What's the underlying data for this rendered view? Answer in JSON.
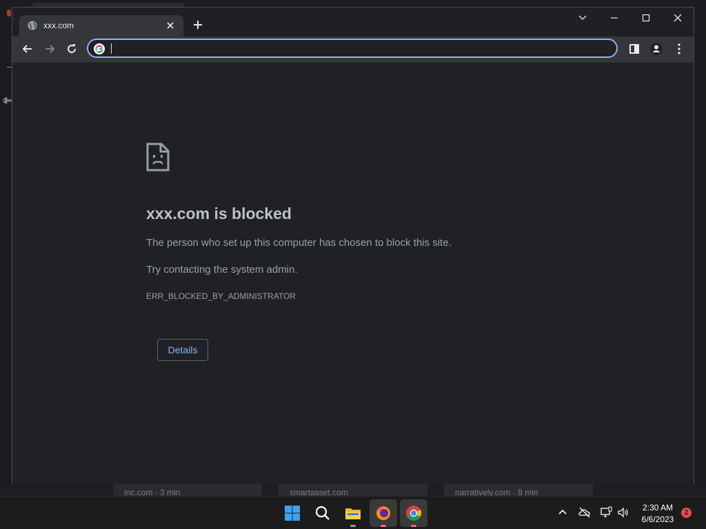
{
  "background": {
    "cards": [
      {
        "text": "inc.com · 3 min"
      },
      {
        "text": "smartasset.com"
      },
      {
        "text": "narratively.com · 8 min"
      }
    ]
  },
  "browser": {
    "tab": {
      "title": "xxx.com",
      "icon": "globe-icon"
    },
    "omnibox": {
      "value": "",
      "placeholder": ""
    },
    "accent": "#8ab4f8"
  },
  "error_page": {
    "heading": "xxx.com is blocked",
    "message": "The person who set up this computer has chosen to block this site.",
    "suggestion": "Try contacting the system admin.",
    "error_code": "ERR_BLOCKED_BY_ADMINISTRATOR",
    "details_label": "Details"
  },
  "taskbar": {
    "apps": [
      {
        "name": "start",
        "icon": "windows-logo-icon"
      },
      {
        "name": "search",
        "icon": "search-icon"
      },
      {
        "name": "file-explorer",
        "icon": "folder-icon"
      },
      {
        "name": "firefox",
        "icon": "firefox-icon"
      },
      {
        "name": "chrome",
        "icon": "chrome-icon"
      }
    ],
    "clock": {
      "time": "2:30 AM",
      "date": "6/6/2023"
    },
    "notification_count": "2"
  }
}
